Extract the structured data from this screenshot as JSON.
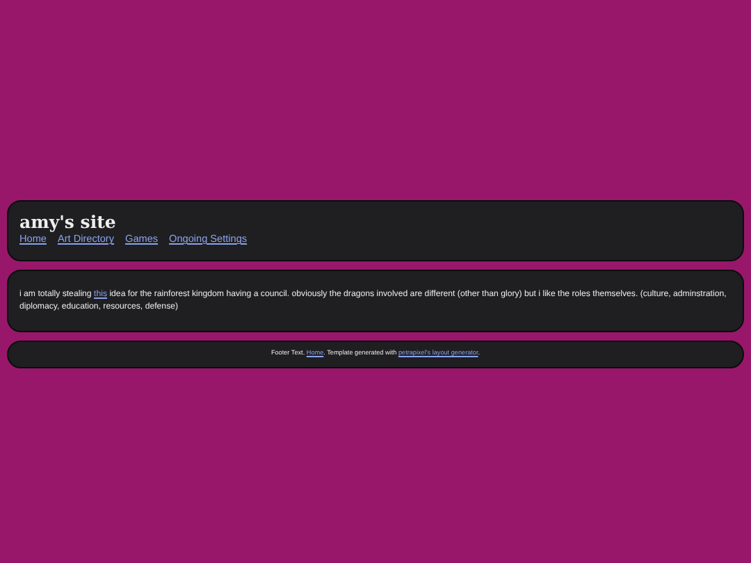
{
  "header": {
    "title": "amy's site",
    "nav": [
      "Home",
      "Art Directory",
      "Games",
      "Ongoing Settings"
    ]
  },
  "post": {
    "before": "i am totally stealing ",
    "link": "this",
    "after": " idea for the rainforest kingdom having a council. obviously the dragons involved are different (other than glory) but i like the roles themselves. (culture, adminstration, diplomacy, education, resources, defense)"
  },
  "footer": {
    "before": "Footer Text. ",
    "link": "Home",
    "middle": ". Template generated with ",
    "link2": "petrapixel's layout generator",
    "after": "."
  }
}
